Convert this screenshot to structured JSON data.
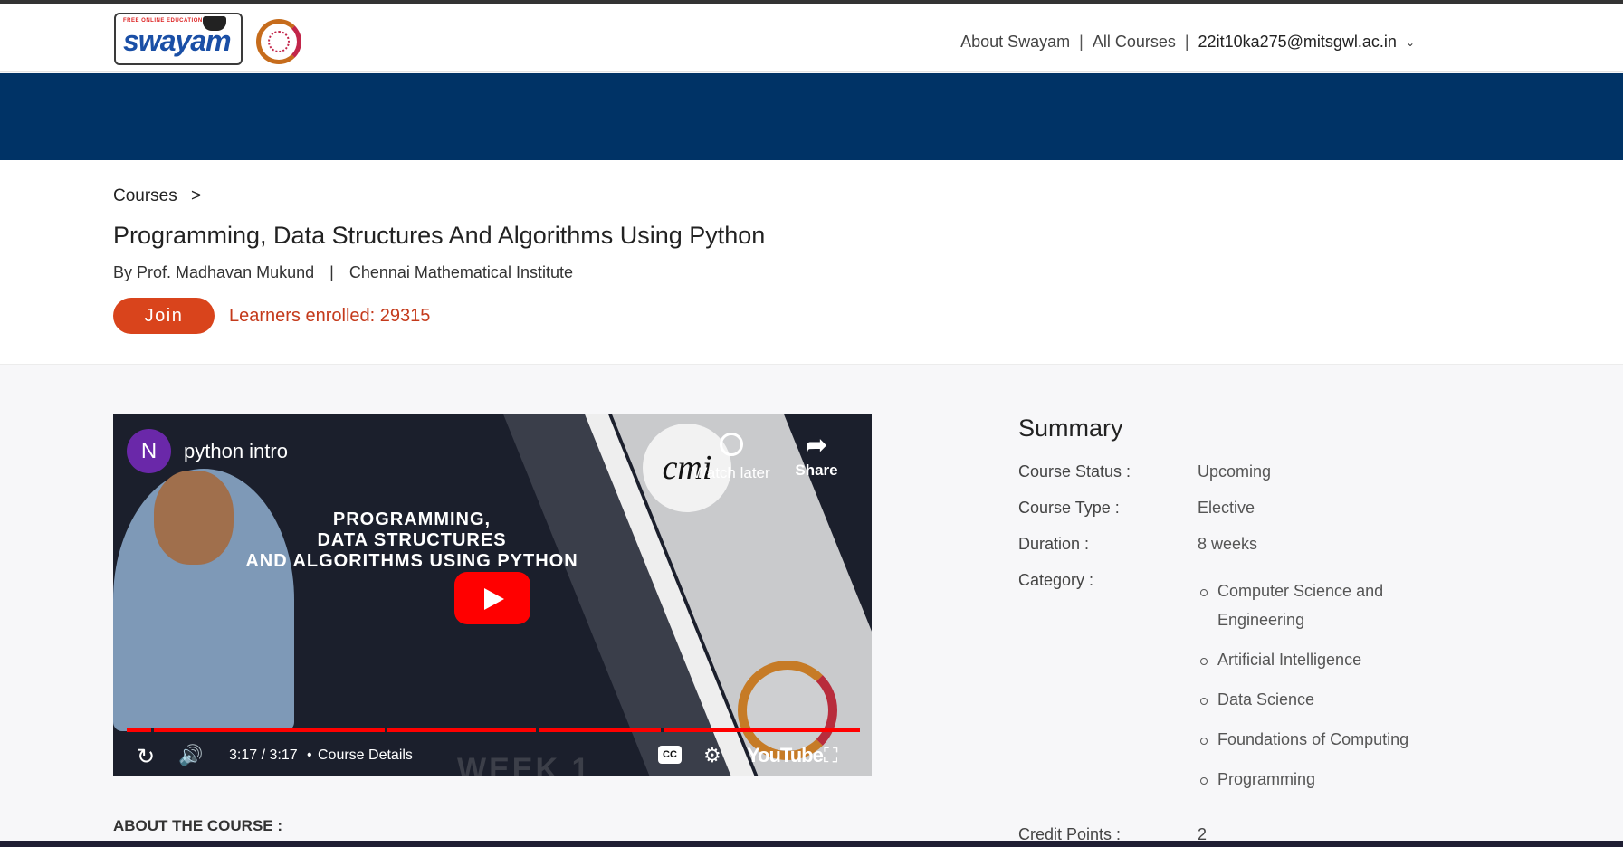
{
  "header": {
    "logo_text": "swayam",
    "logo_tagline": "FREE ONLINE EDUCATION",
    "nav": {
      "about": "About Swayam",
      "all_courses": "All Courses",
      "user_email": "22it10ka275@mitsgwl.ac.in",
      "separator": "|"
    }
  },
  "course": {
    "breadcrumb": "Courses",
    "breadcrumb_arrow": ">",
    "title": "Programming, Data Structures And Algorithms Using Python",
    "instructor": "By Prof. Madhavan Mukund",
    "institute": "Chennai Mathematical Institute",
    "join_label": "Join",
    "enrolled": "Learners enrolled: 29315"
  },
  "video": {
    "channel_initial": "N",
    "title": "python intro",
    "watch_later": "Watch later",
    "share": "Share",
    "slide_text": [
      "PROGRAMMING,",
      "DATA STRUCTURES",
      "AND ALGORITHMS USING PYTHON"
    ],
    "logo_text": "cmi",
    "time": "3:17 / 3:17",
    "chapter": "Course Details",
    "cc": "CC",
    "youtube": "YouTube",
    "week": "WEEK 1",
    "progress_fraction": 1.0
  },
  "about_heading": "ABOUT THE COURSE :",
  "summary": {
    "heading": "Summary",
    "rows": [
      {
        "key": "Course Status :",
        "value": "Upcoming"
      },
      {
        "key": "Course Type :",
        "value": "Elective"
      },
      {
        "key": "Duration :",
        "value": "8 weeks"
      },
      {
        "key": "Category :",
        "value": ""
      }
    ],
    "categories": [
      "Computer Science and Engineering",
      "Artificial Intelligence",
      "Data Science",
      "Foundations of Computing",
      "Programming"
    ],
    "credit_key": "Credit Points :",
    "credit_value": "2"
  },
  "colors": {
    "banner": "#003366",
    "join": "#d9441c",
    "enrolled": "#c43a1b",
    "youtube_red": "#ff0000"
  }
}
